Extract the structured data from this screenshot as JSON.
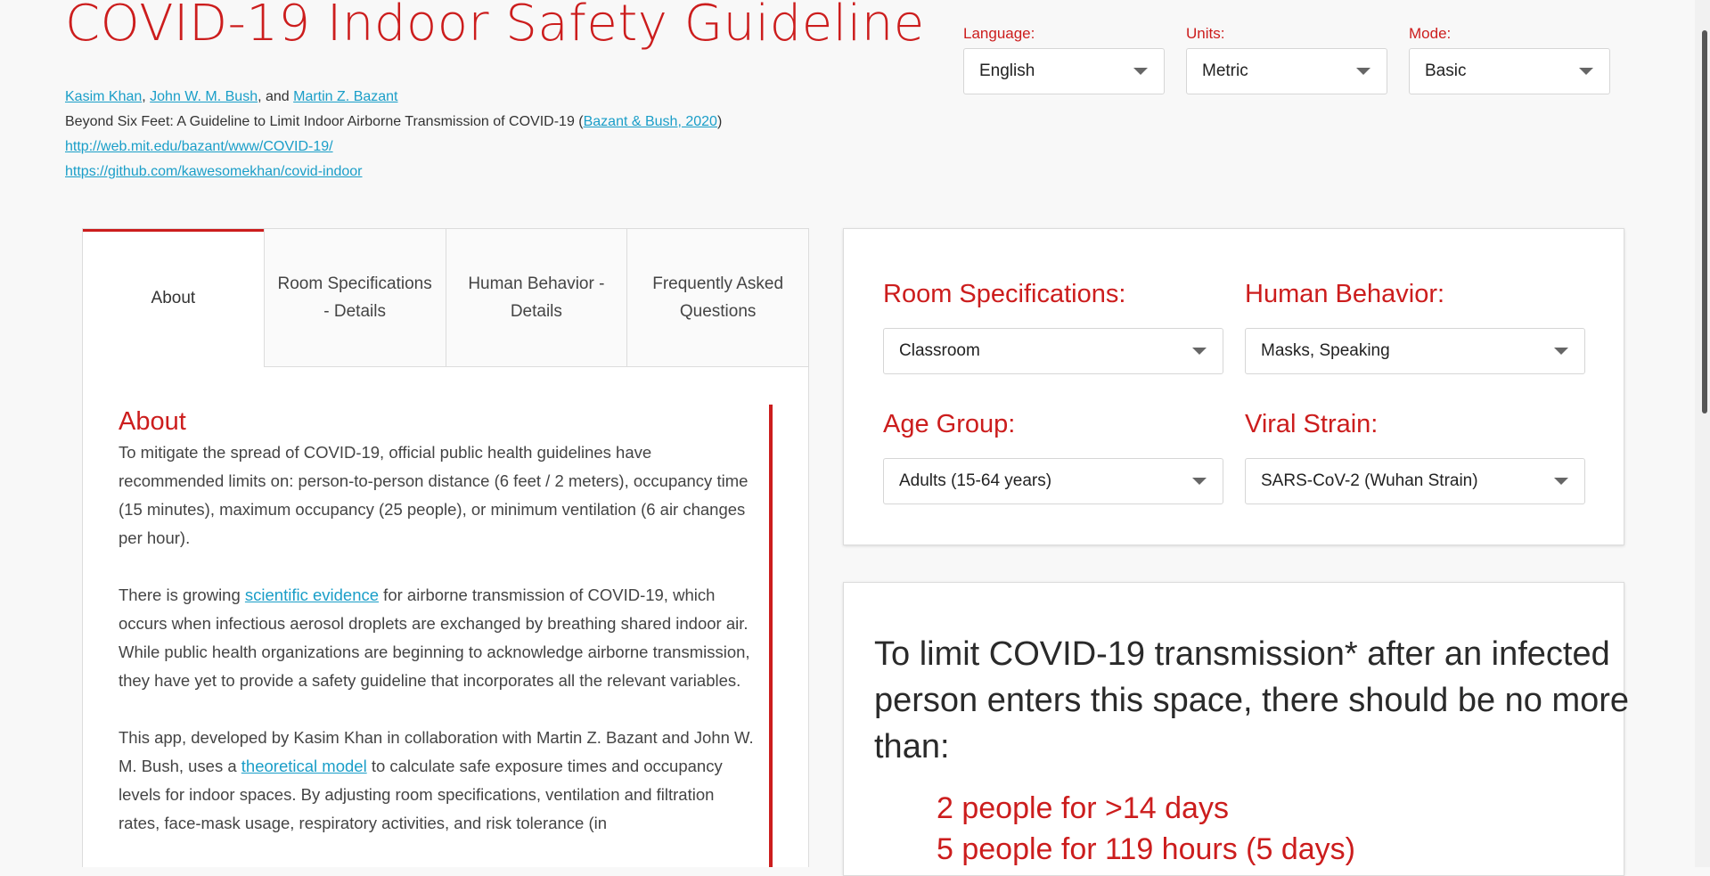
{
  "header": {
    "title": "COVID-19 Indoor Safety Guideline",
    "authors": [
      {
        "name": "Kasim Khan"
      },
      {
        "name": "John W. M. Bush"
      },
      {
        "name": "Martin Z. Bazant"
      }
    ],
    "sep1": ", ",
    "sep2": ", and ",
    "subtitle": "Beyond Six Feet: A Guideline to Limit Indoor Airborne Transmission of COVID-19 (",
    "subtitle_link": "Bazant & Bush, 2020",
    "subtitle_end": ")",
    "link1": "http://web.mit.edu/bazant/www/COVID-19/",
    "link2": "https://github.com/kawesomekhan/covid-indoor"
  },
  "settings": {
    "language": {
      "label": "Language:",
      "value": "English"
    },
    "units": {
      "label": "Units:",
      "value": "Metric"
    },
    "mode": {
      "label": "Mode:",
      "value": "Basic"
    }
  },
  "tabs": [
    {
      "label": "About"
    },
    {
      "label": "Room Specifications - Details"
    },
    {
      "label": "Human Behavior - Details"
    },
    {
      "label": "Frequently Asked Questions"
    }
  ],
  "about": {
    "heading": "About",
    "p1": "To mitigate the spread of COVID-19, official public health guidelines have recommended limits on: person-to-person distance (6 feet / 2 meters), occupancy time (15 minutes), maximum occupancy (25 people), or minimum ventilation (6 air changes per hour).",
    "p2_pre": "There is growing ",
    "p2_link": "scientific evidence",
    "p2_post": " for airborne transmission of COVID-19, which occurs when infectious aerosol droplets are exchanged by breathing shared indoor air. While public health organizations are beginning to acknowledge airborne transmission, they have yet to provide a safety guideline that incorporates all the relevant variables.",
    "p3_pre": "This app, developed by Kasim Khan in collaboration with Martin Z. Bazant and John W. M. Bush, uses a ",
    "p3_link": "theoretical model",
    "p3_post": " to calculate safe exposure times and occupancy levels for indoor spaces. By adjusting room specifications, ventilation and filtration rates, face-mask usage, respiratory activities, and risk tolerance (in"
  },
  "inputs": {
    "room": {
      "label": "Room Specifications:",
      "value": "Classroom"
    },
    "behavior": {
      "label": "Human Behavior:",
      "value": "Masks, Speaking"
    },
    "age": {
      "label": "Age Group:",
      "value": "Adults (15-64 years)"
    },
    "strain": {
      "label": "Viral Strain:",
      "value": "SARS-CoV-2 (Wuhan Strain)"
    }
  },
  "recommendation": {
    "text": "To limit COVID-19 transmission* after an infected person enters this space, there should be no more than:",
    "items": [
      {
        "text": "2 people for >14 days"
      },
      {
        "text": "5 people for 119 hours (5 days)"
      }
    ]
  },
  "colors": {
    "accent": "#cc1d1d",
    "link": "#1a9ec8"
  }
}
